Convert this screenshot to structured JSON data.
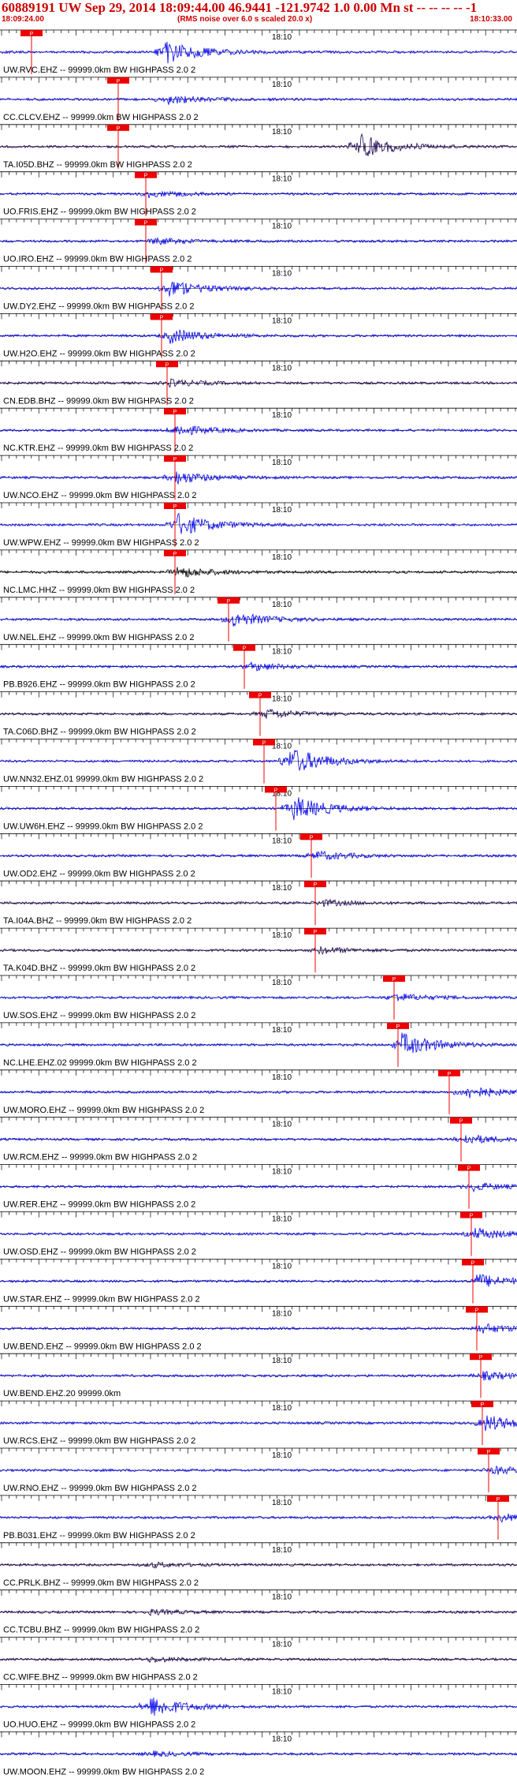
{
  "header": {
    "title": "60889191 UW Sep 29, 2014 18:09:44.00   46.9441 -121.9742  1.0 0.00 Mn st -- -- -- -- -1",
    "time_start": "18:09:24.00",
    "rms_note": "(RMS noise over 6.0 s scaled 20.0 x)",
    "time_end": "18:10:33.00"
  },
  "colors": {
    "trace": "#0000ee",
    "trace_dark": "#1a0050",
    "trace_black": "#000000",
    "pick": "#ee0000",
    "text": "#000000",
    "title": "#cc0000"
  },
  "chart_data": {
    "type": "line",
    "title": "60889191 UW Sep 29, 2014 18:09:44.00   46.9441 -121.9742  1.0 0.00 Mn st -- -- -- -- -1",
    "x_start": "18:09:24.00",
    "x_end": "18:10:33.00",
    "minute_mark": "18:10",
    "channels": [
      {
        "label": "UW.RVC.EHZ -- 99999.0km BW  HIGHPASS  2.0  2",
        "pick": "P",
        "color": "blue"
      },
      {
        "label": "CC.CLCV.EHZ -- 99999.0km BW  HIGHPASS  2.0  2",
        "pick": "P",
        "color": "blue"
      },
      {
        "label": "TA.I05D.BHZ -- 99999.0km BW  HIGHPASS  2.0  2",
        "pick": "P",
        "color": "dark"
      },
      {
        "label": "UO.FRIS.EHZ -- 99999.0km BW  HIGHPASS  2.0  2",
        "pick": "P",
        "color": "blue"
      },
      {
        "label": "UO.IRO.EHZ -- 99999.0km BW  HIGHPASS  2.0  2",
        "pick": "P",
        "color": "blue"
      },
      {
        "label": "UW.DY2.EHZ -- 99999.0km BW  HIGHPASS  2.0  2",
        "pick": "P",
        "color": "blue"
      },
      {
        "label": "UW.H2O.EHZ -- 99999.0km BW  HIGHPASS  2.0  2",
        "pick": "P",
        "color": "blue"
      },
      {
        "label": "CN.EDB.BHZ -- 99999.0km BW  HIGHPASS  2.0  2",
        "pick": "P",
        "color": "dark"
      },
      {
        "label": "NC.KTR.EHZ -- 99999.0km BW  HIGHPASS  2.0  2",
        "pick": "P",
        "color": "blue"
      },
      {
        "label": "UW.NCO.EHZ -- 99999.0km BW  HIGHPASS  2.0  2",
        "pick": "P",
        "color": "blue"
      },
      {
        "label": "UW.WPW.EHZ -- 99999.0km BW  HIGHPASS  2.0  2",
        "pick": "P",
        "color": "blue"
      },
      {
        "label": "NC.LMC.HHZ -- 99999.0km BW  HIGHPASS  2.0  2",
        "pick": "P",
        "color": "black"
      },
      {
        "label": "UW.NEL.EHZ -- 99999.0km BW  HIGHPASS  2.0  2",
        "pick": "P",
        "color": "blue"
      },
      {
        "label": "PB.B926.EHZ -- 99999.0km BW  HIGHPASS  2.0  2",
        "pick": "P",
        "color": "blue"
      },
      {
        "label": "TA.C06D.BHZ -- 99999.0km BW  HIGHPASS  2.0  2",
        "pick": "P",
        "color": "dark"
      },
      {
        "label": "UW.NN32.EHZ.01 99999.0km BW  HIGHPASS  2.0  2",
        "pick": "P",
        "color": "blue"
      },
      {
        "label": "UW.UW6H.EHZ -- 99999.0km BW  HIGHPASS  2.0  2",
        "pick": "P",
        "color": "blue"
      },
      {
        "label": "UW.OD2.EHZ -- 99999.0km BW  HIGHPASS  2.0  2",
        "pick": "P",
        "color": "blue"
      },
      {
        "label": "TA.I04A.BHZ -- 99999.0km BW  HIGHPASS  2.0  2",
        "pick": "P",
        "color": "dark"
      },
      {
        "label": "TA.K04D.BHZ -- 99999.0km BW  HIGHPASS  2.0  2",
        "pick": "P",
        "color": "dark"
      },
      {
        "label": "UW.SOS.EHZ -- 99999.0km BW  HIGHPASS  2.0  2",
        "pick": "P",
        "color": "blue"
      },
      {
        "label": "NC.LHE.EHZ.02 99999.0km BW  HIGHPASS  2.0  2",
        "pick": "P",
        "color": "blue"
      },
      {
        "label": "UW.MORO.EHZ -- 99999.0km BW  HIGHPASS  2.0  2",
        "pick": "P",
        "color": "blue"
      },
      {
        "label": "UW.RCM.EHZ -- 99999.0km BW  HIGHPASS  2.0  2",
        "pick": "P",
        "color": "blue"
      },
      {
        "label": "UW.RER.EHZ -- 99999.0km BW  HIGHPASS  2.0  2",
        "pick": "P",
        "color": "blue"
      },
      {
        "label": "UW.OSD.EHZ -- 99999.0km BW  HIGHPASS  2.0  2",
        "pick": "P",
        "color": "blue"
      },
      {
        "label": "UW.STAR.EHZ -- 99999.0km BW  HIGHPASS  2.0  2",
        "pick": "P",
        "color": "blue"
      },
      {
        "label": "UW.BEND.EHZ -- 99999.0km BW  HIGHPASS  2.0  2",
        "pick": "P",
        "color": "blue"
      },
      {
        "label": "UW.BEND.EHZ.20 99999.0km",
        "pick": "P",
        "color": "blue"
      },
      {
        "label": "UW.RCS.EHZ -- 99999.0km BW  HIGHPASS  2.0  2",
        "pick": "P",
        "color": "blue"
      },
      {
        "label": "UW.RNO.EHZ -- 99999.0km BW  HIGHPASS  2.0  2",
        "pick": "P",
        "color": "blue"
      },
      {
        "label": "PB.B031.EHZ -- 99999.0km BW  HIGHPASS  2.0  2",
        "pick": "P",
        "color": "blue"
      },
      {
        "label": "CC.PRLK.BHZ -- 99999.0km BW  HIGHPASS  2.0  2",
        "pick": "",
        "color": "dark"
      },
      {
        "label": "CC.TCBU.BHZ -- 99999.0km BW  HIGHPASS  2.0  2",
        "pick": "",
        "color": "dark"
      },
      {
        "label": "CC.WIFE.BHZ -- 99999.0km BW  HIGHPASS  2.0  2",
        "pick": "",
        "color": "dark"
      },
      {
        "label": "UO.HUO.EHZ -- 99999.0km BW  HIGHPASS  2.0  2",
        "pick": "",
        "color": "blue"
      },
      {
        "label": "UW.MOON.EHZ -- 99999.0km BW  HIGHPASS  2.0  2",
        "pick": "",
        "color": "blue"
      }
    ]
  }
}
